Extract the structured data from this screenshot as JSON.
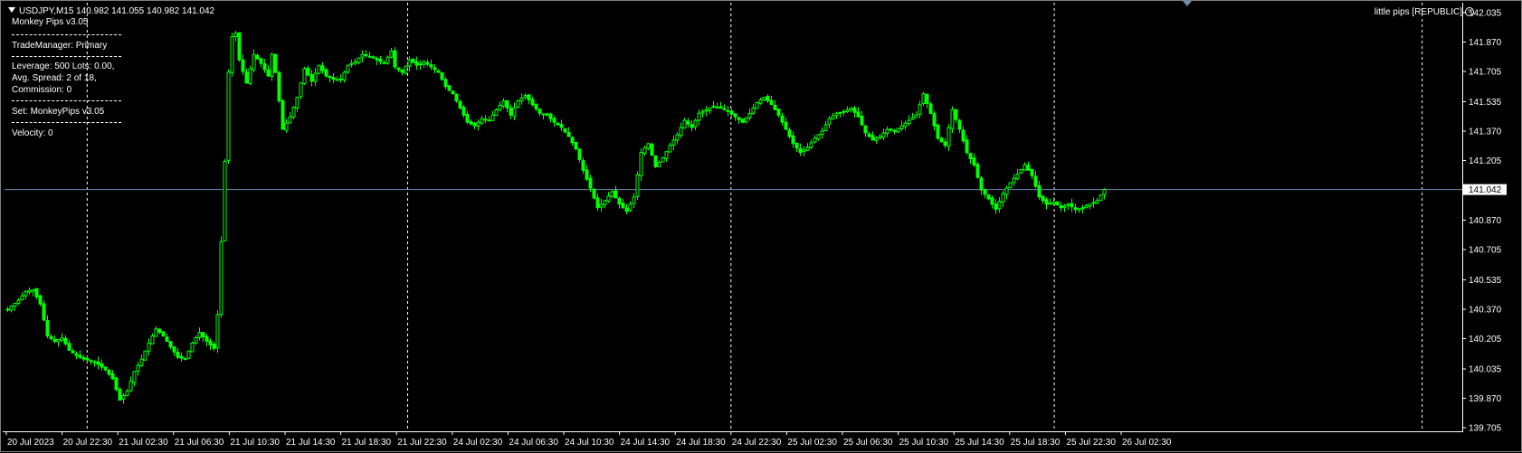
{
  "header": {
    "symbol_line": "USDJPY,M15  140.982 141.055 140.982 141.042"
  },
  "panel": {
    "title": "Monkey Pips v3.05",
    "trade_manager": "TradeManager: Primary",
    "leverage": "Leverage: 500 Lots: 0.00,",
    "spread": "Avg. Spread: 2 of 18,",
    "commission": "Commission: 0",
    "set": "Set: MonkeyPips v3.05",
    "velocity": "Velocity: 0"
  },
  "brand": "little pips [REPUBLIC]",
  "colors": {
    "background": "#000000",
    "candle": "#00ff00",
    "axis": "#ffffff",
    "price_line": "#6d8fb1",
    "period_separator": "#ffffff"
  },
  "chart_data": {
    "type": "candlestick",
    "symbol": "USDJPY",
    "timeframe": "M15",
    "current_price": 141.042,
    "ylim": [
      139.705,
      142.035
    ],
    "y_ticks": [
      142.035,
      141.87,
      141.705,
      141.535,
      141.37,
      141.205,
      140.87,
      140.705,
      140.535,
      140.37,
      140.205,
      140.035,
      139.87,
      139.705
    ],
    "x_ticks": [
      "20 Jul 2023",
      "20 Jul 22:30",
      "21 Jul 02:30",
      "21 Jul 06:30",
      "21 Jul 10:30",
      "21 Jul 14:30",
      "21 Jul 18:30",
      "21 Jul 22:30",
      "24 Jul 02:30",
      "24 Jul 06:30",
      "24 Jul 10:30",
      "24 Jul 14:30",
      "24 Jul 18:30",
      "24 Jul 22:30",
      "25 Jul 02:30",
      "25 Jul 06:30",
      "25 Jul 10:30",
      "25 Jul 14:30",
      "25 Jul 18:30",
      "25 Jul 22:30",
      "26 Jul 02:30"
    ],
    "day_separators": [
      "21 Jul",
      "24 Jul",
      "25 Jul",
      "26 Jul"
    ],
    "close_path": [
      [
        0,
        140.37
      ],
      [
        3,
        140.42
      ],
      [
        5,
        140.47
      ],
      [
        7,
        140.48
      ],
      [
        9,
        140.4
      ],
      [
        11,
        140.22
      ],
      [
        13,
        140.19
      ],
      [
        15,
        140.21
      ],
      [
        17,
        140.14
      ],
      [
        19,
        140.11
      ],
      [
        21,
        140.09
      ],
      [
        23,
        140.08
      ],
      [
        25,
        140.06
      ],
      [
        27,
        140.03
      ],
      [
        29,
        139.98
      ],
      [
        31,
        139.86
      ],
      [
        33,
        139.91
      ],
      [
        35,
        140.02
      ],
      [
        37,
        140.09
      ],
      [
        39,
        140.18
      ],
      [
        41,
        140.26
      ],
      [
        43,
        140.22
      ],
      [
        45,
        140.16
      ],
      [
        47,
        140.1
      ],
      [
        49,
        140.09
      ],
      [
        51,
        140.18
      ],
      [
        53,
        140.24
      ],
      [
        55,
        140.19
      ],
      [
        57,
        140.15
      ],
      [
        58,
        140.34
      ],
      [
        59,
        140.75
      ],
      [
        60,
        141.2
      ],
      [
        61,
        141.7
      ],
      [
        62,
        141.9
      ],
      [
        63,
        141.92
      ],
      [
        64,
        141.77
      ],
      [
        66,
        141.64
      ],
      [
        68,
        141.8
      ],
      [
        70,
        141.75
      ],
      [
        72,
        141.68
      ],
      [
        73,
        141.8
      ],
      [
        74,
        141.7
      ],
      [
        76,
        141.38
      ],
      [
        78,
        141.45
      ],
      [
        80,
        141.56
      ],
      [
        82,
        141.72
      ],
      [
        84,
        141.65
      ],
      [
        86,
        141.74
      ],
      [
        88,
        141.68
      ],
      [
        90,
        141.66
      ],
      [
        92,
        141.66
      ],
      [
        94,
        141.74
      ],
      [
        96,
        141.76
      ],
      [
        98,
        141.8
      ],
      [
        100,
        141.79
      ],
      [
        102,
        141.77
      ],
      [
        104,
        141.75
      ],
      [
        106,
        141.82
      ],
      [
        107,
        141.73
      ],
      [
        109,
        141.7
      ],
      [
        111,
        141.77
      ],
      [
        113,
        141.74
      ],
      [
        115,
        141.76
      ],
      [
        117,
        141.73
      ],
      [
        119,
        141.7
      ],
      [
        121,
        141.62
      ],
      [
        123,
        141.58
      ],
      [
        125,
        141.5
      ],
      [
        127,
        141.42
      ],
      [
        129,
        141.4
      ],
      [
        131,
        141.44
      ],
      [
        133,
        141.43
      ],
      [
        135,
        141.49
      ],
      [
        137,
        141.54
      ],
      [
        139,
        141.46
      ],
      [
        141,
        141.54
      ],
      [
        143,
        141.57
      ],
      [
        145,
        141.52
      ],
      [
        147,
        141.47
      ],
      [
        149,
        141.46
      ],
      [
        151,
        141.42
      ],
      [
        153,
        141.39
      ],
      [
        155,
        141.34
      ],
      [
        157,
        141.27
      ],
      [
        159,
        141.15
      ],
      [
        161,
        141.05
      ],
      [
        163,
        140.94
      ],
      [
        165,
        140.98
      ],
      [
        167,
        141.03
      ],
      [
        169,
        140.96
      ],
      [
        171,
        140.92
      ],
      [
        173,
        141.0
      ],
      [
        175,
        141.25
      ],
      [
        177,
        141.3
      ],
      [
        179,
        141.17
      ],
      [
        181,
        141.22
      ],
      [
        183,
        141.29
      ],
      [
        185,
        141.35
      ],
      [
        187,
        141.43
      ],
      [
        189,
        141.39
      ],
      [
        191,
        141.47
      ],
      [
        193,
        141.49
      ],
      [
        195,
        141.51
      ],
      [
        197,
        141.5
      ],
      [
        199,
        141.48
      ],
      [
        201,
        141.45
      ],
      [
        203,
        141.42
      ],
      [
        205,
        141.47
      ],
      [
        207,
        141.53
      ],
      [
        209,
        141.56
      ],
      [
        211,
        141.52
      ],
      [
        213,
        141.46
      ],
      [
        215,
        141.38
      ],
      [
        217,
        141.3
      ],
      [
        219,
        141.25
      ],
      [
        221,
        141.28
      ],
      [
        223,
        141.33
      ],
      [
        225,
        141.37
      ],
      [
        227,
        141.44
      ],
      [
        229,
        141.47
      ],
      [
        231,
        141.48
      ],
      [
        233,
        141.5
      ],
      [
        235,
        141.45
      ],
      [
        237,
        141.36
      ],
      [
        239,
        141.32
      ],
      [
        241,
        141.34
      ],
      [
        243,
        141.38
      ],
      [
        245,
        141.37
      ],
      [
        247,
        141.4
      ],
      [
        249,
        141.43
      ],
      [
        251,
        141.46
      ],
      [
        253,
        141.58
      ],
      [
        255,
        141.47
      ],
      [
        257,
        141.33
      ],
      [
        259,
        141.29
      ],
      [
        261,
        141.49
      ],
      [
        263,
        141.38
      ],
      [
        265,
        141.25
      ],
      [
        267,
        141.18
      ],
      [
        269,
        141.04
      ],
      [
        271,
        140.99
      ],
      [
        273,
        140.93
      ],
      [
        275,
        141.02
      ],
      [
        277,
        141.08
      ],
      [
        279,
        141.13
      ],
      [
        281,
        141.18
      ],
      [
        283,
        141.12
      ],
      [
        285,
        141.0
      ],
      [
        287,
        140.96
      ],
      [
        289,
        140.97
      ],
      [
        291,
        140.94
      ],
      [
        293,
        140.96
      ],
      [
        295,
        140.93
      ],
      [
        297,
        140.94
      ],
      [
        299,
        140.96
      ],
      [
        301,
        140.98
      ],
      [
        303,
        141.042
      ]
    ]
  }
}
